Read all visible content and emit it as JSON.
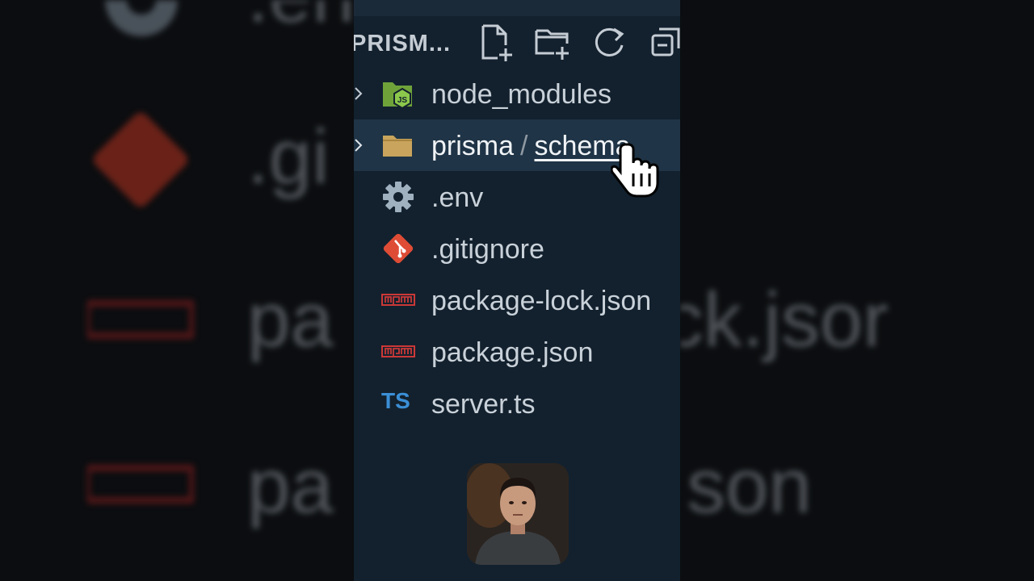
{
  "explorer": {
    "title": "PRISM...",
    "toolbar": {
      "new_file": "new-file-icon",
      "new_folder": "new-folder-icon",
      "refresh": "refresh-icon",
      "collapse": "collapse-all-icon"
    },
    "items": [
      {
        "label": "node_modules",
        "icon": "nodejs-folder-icon",
        "type": "folder",
        "expandable": true
      },
      {
        "label_part1": "prisma",
        "separator": "/",
        "label_part2": "schema",
        "icon": "folder-icon",
        "type": "folder",
        "expandable": true,
        "selected": true
      },
      {
        "label": ".env",
        "icon": "gear-icon",
        "type": "file"
      },
      {
        "label": ".gitignore",
        "icon": "git-icon",
        "type": "file"
      },
      {
        "label": "package-lock.json",
        "icon": "npm-icon",
        "type": "file"
      },
      {
        "label": "package.json",
        "icon": "npm-icon",
        "type": "file"
      },
      {
        "label": "server.ts",
        "icon": "typescript-icon",
        "icon_text": "TS",
        "type": "file"
      }
    ]
  },
  "background": {
    "left_words": [
      ".en",
      ".gi",
      "pa",
      "pa"
    ],
    "right_words": [
      "lock.jsor",
      "son"
    ]
  },
  "colors": {
    "panel_bg": "#13212e",
    "selected_bg": "#1f3446",
    "text": "#c9d1d9",
    "git_red": "#de4c36",
    "npm_red": "#cb3837",
    "node_green": "#8cc84b",
    "folder_tan": "#c9a45c",
    "ts_blue": "#3b8fd6"
  }
}
